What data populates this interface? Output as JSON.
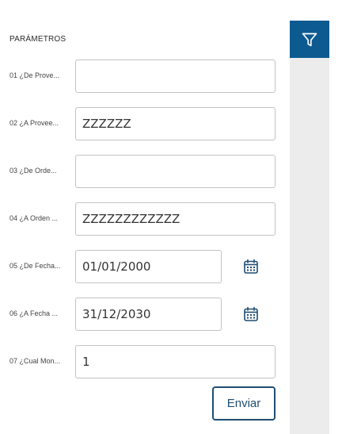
{
  "section_title": "PARÁMETROS",
  "colors": {
    "accent": "#0d5a91",
    "button_border": "#1f4e73",
    "sidebar_bg": "#ececec"
  },
  "params": [
    {
      "label": "01 ¿De Prove...",
      "value": "",
      "date_picker": false
    },
    {
      "label": "02 ¿A Provee...",
      "value": "ZZZZZZ",
      "date_picker": false
    },
    {
      "label": "03 ¿De Orde...",
      "value": "",
      "date_picker": false
    },
    {
      "label": "04 ¿A Orden ...",
      "value": "ZZZZZZZZZZZZ",
      "date_picker": false
    },
    {
      "label": "05 ¿De Fecha...",
      "value": "01/01/2000",
      "date_picker": true,
      "icon": "calendar-icon"
    },
    {
      "label": "06 ¿A Fecha ...",
      "value": "31/12/2030",
      "date_picker": true,
      "icon": "calendar-icon"
    },
    {
      "label": "07 ¿Cual Mon...",
      "value": "1",
      "date_picker": false
    }
  ],
  "submit_label": "Enviar",
  "sidebar": {
    "filter_icon": "filter-icon"
  }
}
